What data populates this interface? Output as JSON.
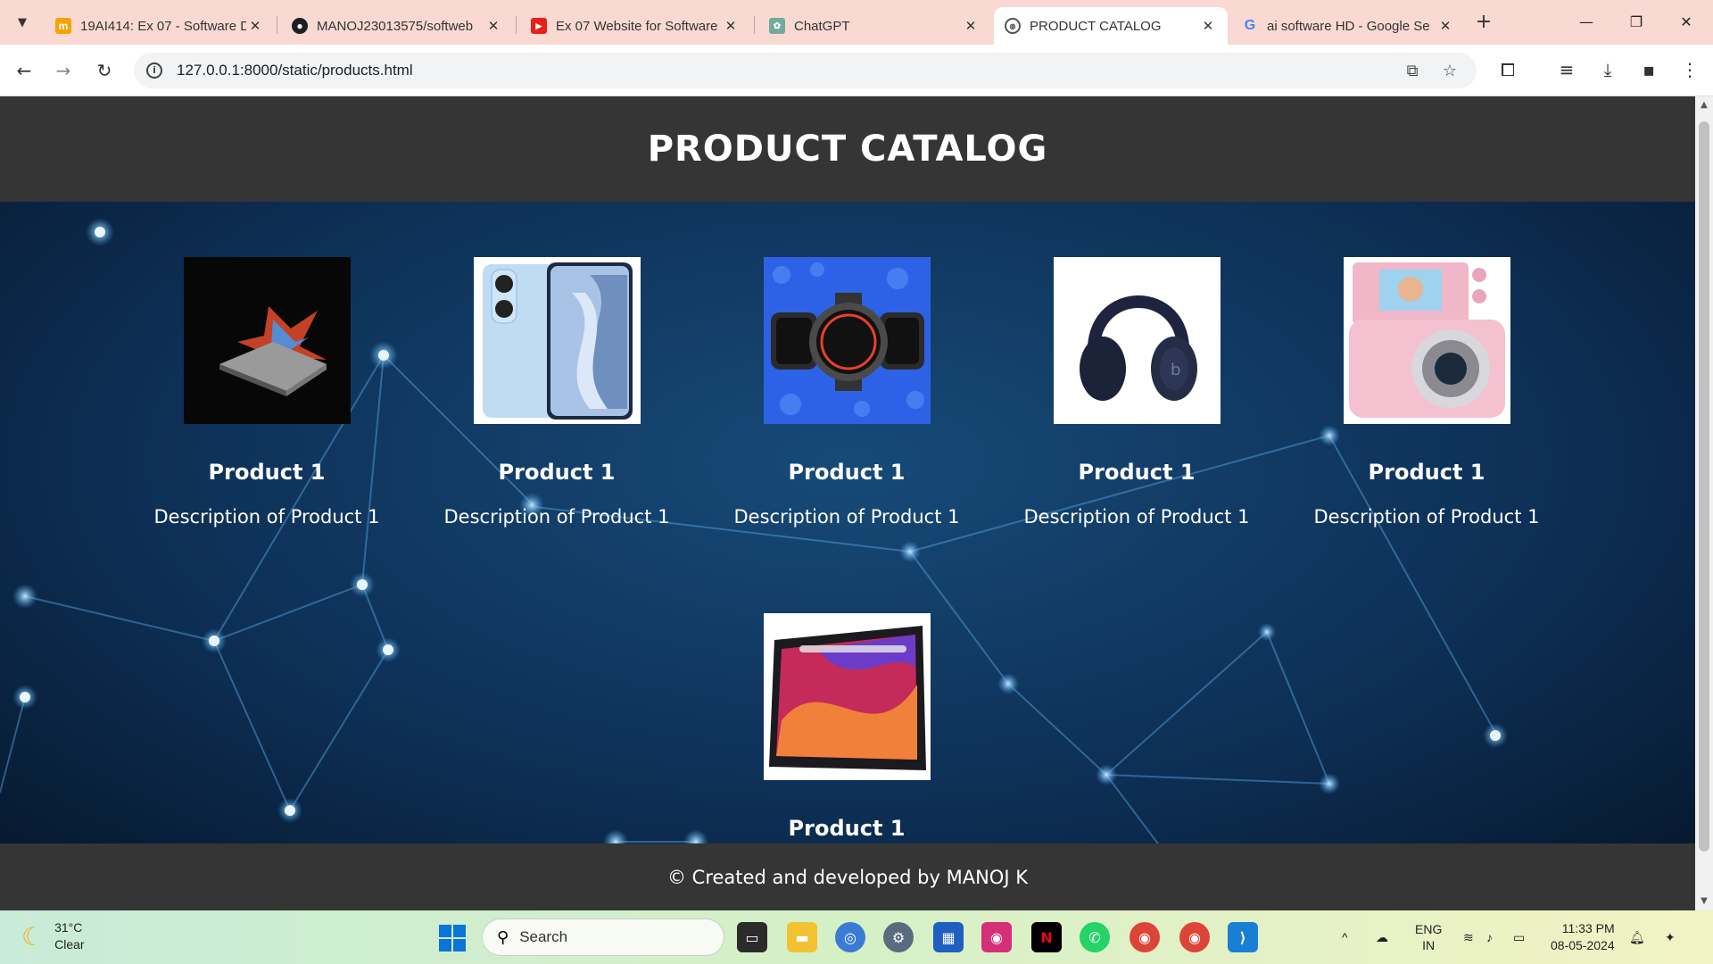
{
  "browser": {
    "tabs": [
      {
        "title": "19AI414: Ex 07 - Software D",
        "active": false
      },
      {
        "title": "MANOJ23013575/softweb",
        "active": false
      },
      {
        "title": "Ex 07 Website for Software",
        "active": false
      },
      {
        "title": "ChatGPT",
        "active": false
      },
      {
        "title": "PRODUCT CATALOG",
        "active": true
      },
      {
        "title": "ai software HD - Google Se",
        "active": false
      }
    ],
    "url": "127.0.0.1:8000/static/products.html"
  },
  "page": {
    "header_title": "PRODUCT CATALOG",
    "products": [
      {
        "name": "Product 1",
        "description": "Description of Product 1",
        "image": "laptop"
      },
      {
        "name": "Product 1",
        "description": "Description of Product 1",
        "image": "smartphone"
      },
      {
        "name": "Product 1",
        "description": "Description of Product 1",
        "image": "smartwatches"
      },
      {
        "name": "Product 1",
        "description": "Description of Product 1",
        "image": "headphones"
      },
      {
        "name": "Product 1",
        "description": "Description of Product 1",
        "image": "camera"
      },
      {
        "name": "Product 1",
        "description": "",
        "image": "tablet"
      }
    ],
    "footer_text": "© Created and developed by MANOJ K"
  },
  "taskbar": {
    "weather_temp": "31°C",
    "weather_desc": "Clear",
    "search_label": "Search",
    "lang_top": "ENG",
    "lang_bottom": "IN",
    "time": "11:33 PM",
    "date": "08-05-2024"
  }
}
